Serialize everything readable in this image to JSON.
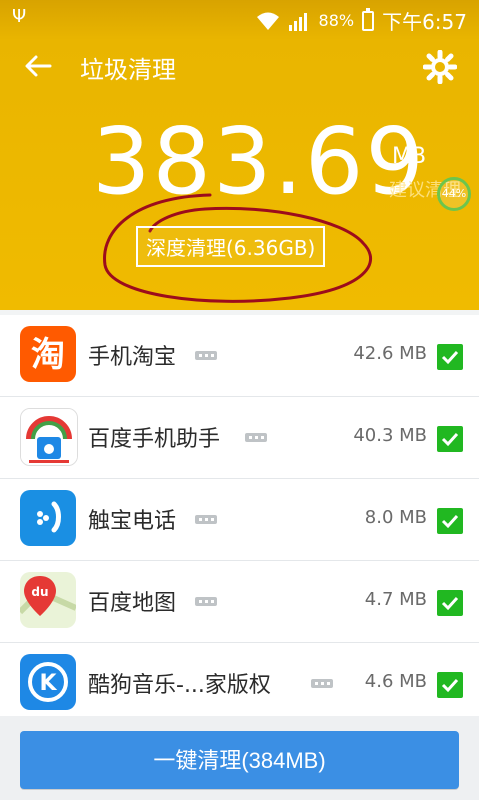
{
  "status": {
    "battery": "88%",
    "time": "下午6:57"
  },
  "appbar": {
    "title": "垃圾清理"
  },
  "summary": {
    "amount": "383.69",
    "unit": "MB",
    "suggest": "建议清理",
    "percent": "44%",
    "deep_clean": "深度清理(6.36GB)"
  },
  "items": [
    {
      "name": "手机淘宝",
      "size": "42.6 MB",
      "checked": true,
      "icon": "taobao-icon"
    },
    {
      "name": "百度手机助手",
      "size": "40.3 MB",
      "checked": true,
      "icon": "baidu-assistant-icon"
    },
    {
      "name": "触宝电话",
      "size": "8.0 MB",
      "checked": true,
      "icon": "touchpal-icon"
    },
    {
      "name": "百度地图",
      "size": "4.7 MB",
      "checked": true,
      "icon": "baidu-map-icon"
    },
    {
      "name": "酷狗音乐-...家版权",
      "size": "4.6 MB",
      "checked": true,
      "icon": "kugou-icon"
    }
  ],
  "action": {
    "label": "一键清理(384MB)"
  },
  "colors": {
    "header": "#f0bb00",
    "check": "#21b821",
    "button": "#3b8fe4"
  }
}
